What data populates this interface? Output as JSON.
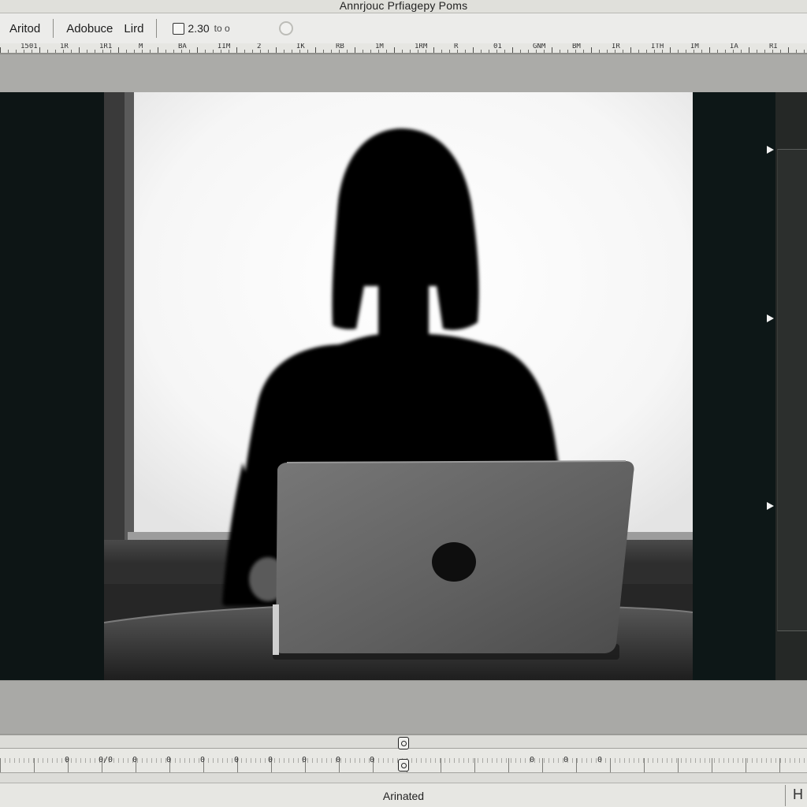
{
  "window": {
    "title": "Annrjouc Prfiagepy Poms"
  },
  "toolbar": {
    "item1_label": "Aritod",
    "item2_label": "Adobuce",
    "item3_label": "Lird",
    "zoom_value": "2.30",
    "zoom_unit": "to o",
    "checkbox_checked": false
  },
  "ruler": {
    "labels": [
      "1501",
      "1R",
      "1R1",
      "M",
      "BA",
      "IIM",
      "2",
      "IK",
      "RB",
      "1M",
      "1RM",
      "R",
      "01",
      "GNM",
      "BM",
      "IR",
      "ITH",
      "IM",
      "IA",
      "RI"
    ]
  },
  "timeline": {
    "labels": [
      "0",
      "0/0",
      "0",
      "0",
      "0",
      "0",
      "0",
      "0",
      "0",
      "0",
      "0",
      "0",
      "0"
    ]
  },
  "status": {
    "text": "Arinated",
    "right_glyph": "H"
  },
  "colors": {
    "panel_dark": "#0d1515",
    "workspace_gray": "#a8a8a5",
    "toolbar_bg": "#ececea"
  }
}
